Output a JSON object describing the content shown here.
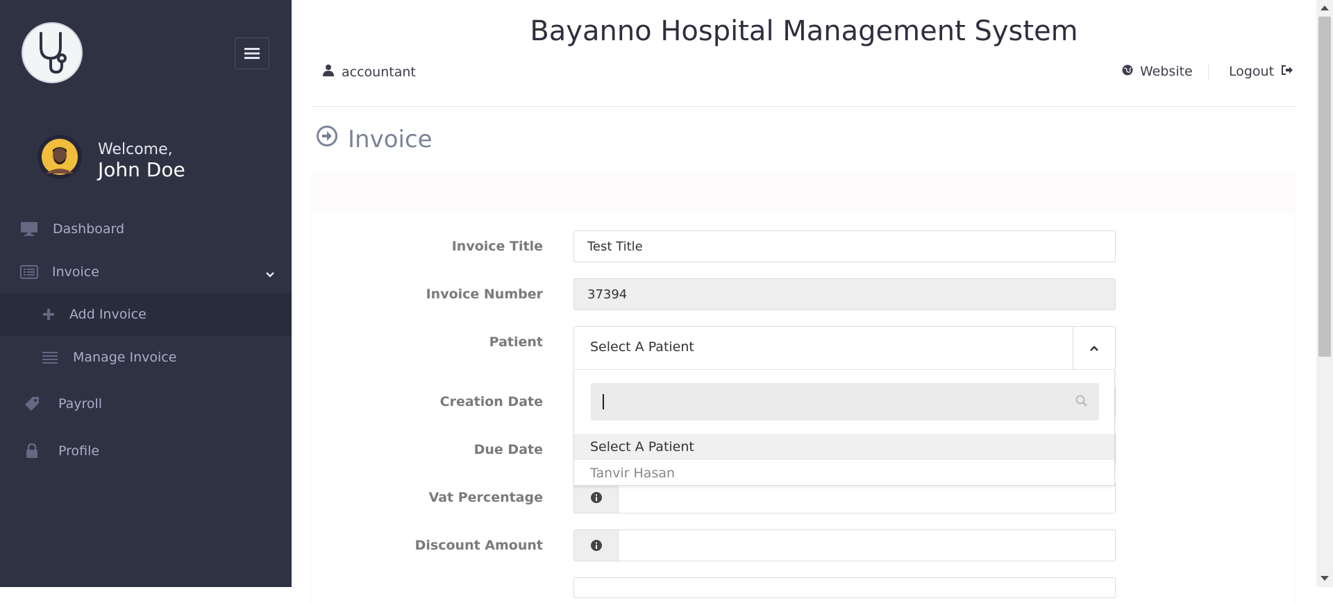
{
  "app": {
    "title": "Bayanno Hospital Management System"
  },
  "header": {
    "user": "accountant",
    "website": "Website",
    "logout": "Logout"
  },
  "sidebar": {
    "welcome": "Welcome,",
    "username": "John Doe",
    "items": [
      {
        "label": "Dashboard",
        "icon": "monitor-icon"
      },
      {
        "label": "Invoice",
        "icon": "list-alt-icon",
        "expanded": true
      },
      {
        "label": "Add Invoice",
        "icon": "plus-icon",
        "sub": true,
        "active": true
      },
      {
        "label": "Manage Invoice",
        "icon": "list-icon",
        "sub": true
      },
      {
        "label": "Payroll",
        "icon": "tag-icon"
      },
      {
        "label": "Profile",
        "icon": "lock-icon"
      }
    ]
  },
  "page": {
    "title": "Invoice"
  },
  "form": {
    "invoice_title": {
      "label": "Invoice Title",
      "value": "Test Title"
    },
    "invoice_number": {
      "label": "Invoice Number",
      "value": "37394"
    },
    "patient": {
      "label": "Patient",
      "selected": "Select A Patient"
    },
    "creation_date": {
      "label": "Creation Date"
    },
    "due_date": {
      "label": "Due Date"
    },
    "vat_percentage": {
      "label": "Vat Percentage"
    },
    "discount_amount": {
      "label": "Discount Amount"
    }
  },
  "dropdown": {
    "search_value": "",
    "options": [
      "Select A Patient",
      "Tanvir Hasan"
    ]
  },
  "colors": {
    "sidebar_bg": "#2f3243",
    "accent_text": "#a9aec8"
  }
}
